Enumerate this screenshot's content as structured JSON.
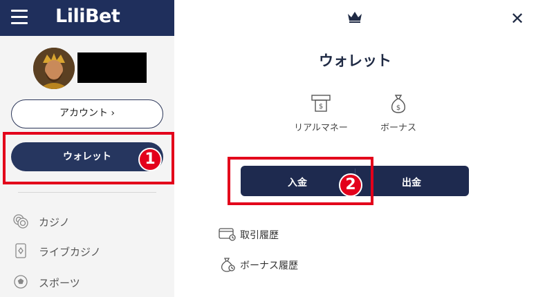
{
  "header": {
    "logo_text": "LiliBet",
    "brand_color": "#1f2f5c"
  },
  "sidebar": {
    "account_label": "アカウント ›",
    "wallet_label": "ウォレット",
    "annotation_1": "1",
    "nav_items": [
      {
        "label": "カジノ",
        "icon": "chips-icon"
      },
      {
        "label": "ライブカジノ",
        "icon": "playing-card-icon"
      },
      {
        "label": "スポーツ",
        "icon": "soccer-ball-icon"
      }
    ]
  },
  "wallet_panel": {
    "title": "ウォレット",
    "tabs": [
      {
        "label": "リアルマネー",
        "icon": "atm-icon"
      },
      {
        "label": "ボーナス",
        "icon": "money-bag-icon"
      }
    ],
    "deposit_label": "入金",
    "withdraw_label": "出金",
    "annotation_2": "2",
    "history_links": [
      {
        "label": "取引履歴",
        "icon": "card-history-icon"
      },
      {
        "label": "ボーナス履歴",
        "icon": "bonus-bag-icon"
      }
    ]
  },
  "colors": {
    "accent": "#26365f",
    "highlight": "#e3001b"
  }
}
